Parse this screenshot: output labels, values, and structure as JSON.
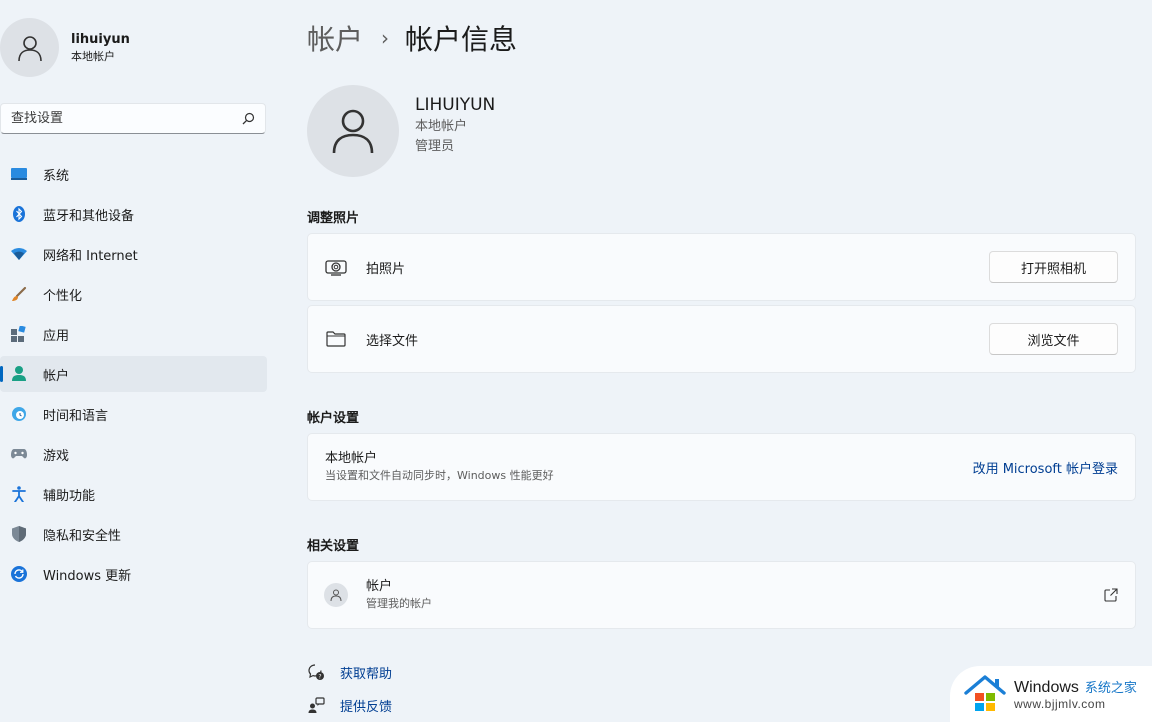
{
  "user": {
    "name": "lihuiyun",
    "type": "本地帐户"
  },
  "search": {
    "placeholder": "查找设置"
  },
  "sidebar": {
    "items": [
      {
        "label": "系统",
        "icon": "monitor-icon"
      },
      {
        "label": "蓝牙和其他设备",
        "icon": "bluetooth-icon"
      },
      {
        "label": "网络和 Internet",
        "icon": "wifi-icon"
      },
      {
        "label": "个性化",
        "icon": "brush-icon"
      },
      {
        "label": "应用",
        "icon": "apps-icon"
      },
      {
        "label": "帐户",
        "icon": "person-icon",
        "active": true
      },
      {
        "label": "时间和语言",
        "icon": "globe-clock-icon"
      },
      {
        "label": "游戏",
        "icon": "gamepad-icon"
      },
      {
        "label": "辅助功能",
        "icon": "accessibility-icon"
      },
      {
        "label": "隐私和安全性",
        "icon": "shield-icon"
      },
      {
        "label": "Windows 更新",
        "icon": "update-icon"
      }
    ]
  },
  "breadcrumb": {
    "parent": "帐户",
    "separator": "›",
    "current": "帐户信息"
  },
  "profile": {
    "name": "LIHUIYUN",
    "type": "本地帐户",
    "role": "管理员"
  },
  "sections": {
    "photo": {
      "title": "调整照片",
      "rows": [
        {
          "label": "拍照片",
          "button": "打开照相机",
          "icon": "camera-icon"
        },
        {
          "label": "选择文件",
          "button": "浏览文件",
          "icon": "folder-icon"
        }
      ]
    },
    "account": {
      "title": "帐户设置",
      "row": {
        "title": "本地帐户",
        "subtitle": "当设置和文件自动同步时，Windows 性能更好",
        "action": "改用 Microsoft 帐户登录"
      }
    },
    "related": {
      "title": "相关设置",
      "row": {
        "title": "帐户",
        "subtitle": "管理我的帐户",
        "icon": "external-link-icon"
      }
    }
  },
  "help": [
    {
      "label": "获取帮助",
      "icon": "help-icon"
    },
    {
      "label": "提供反馈",
      "icon": "feedback-icon"
    }
  ],
  "watermark": {
    "brand": "Windows",
    "site": "系统之家",
    "url": "www.bjjmlv.com"
  },
  "colors": {
    "accent": "#0067c0",
    "link": "#003e92",
    "background": "#eef3f8"
  }
}
